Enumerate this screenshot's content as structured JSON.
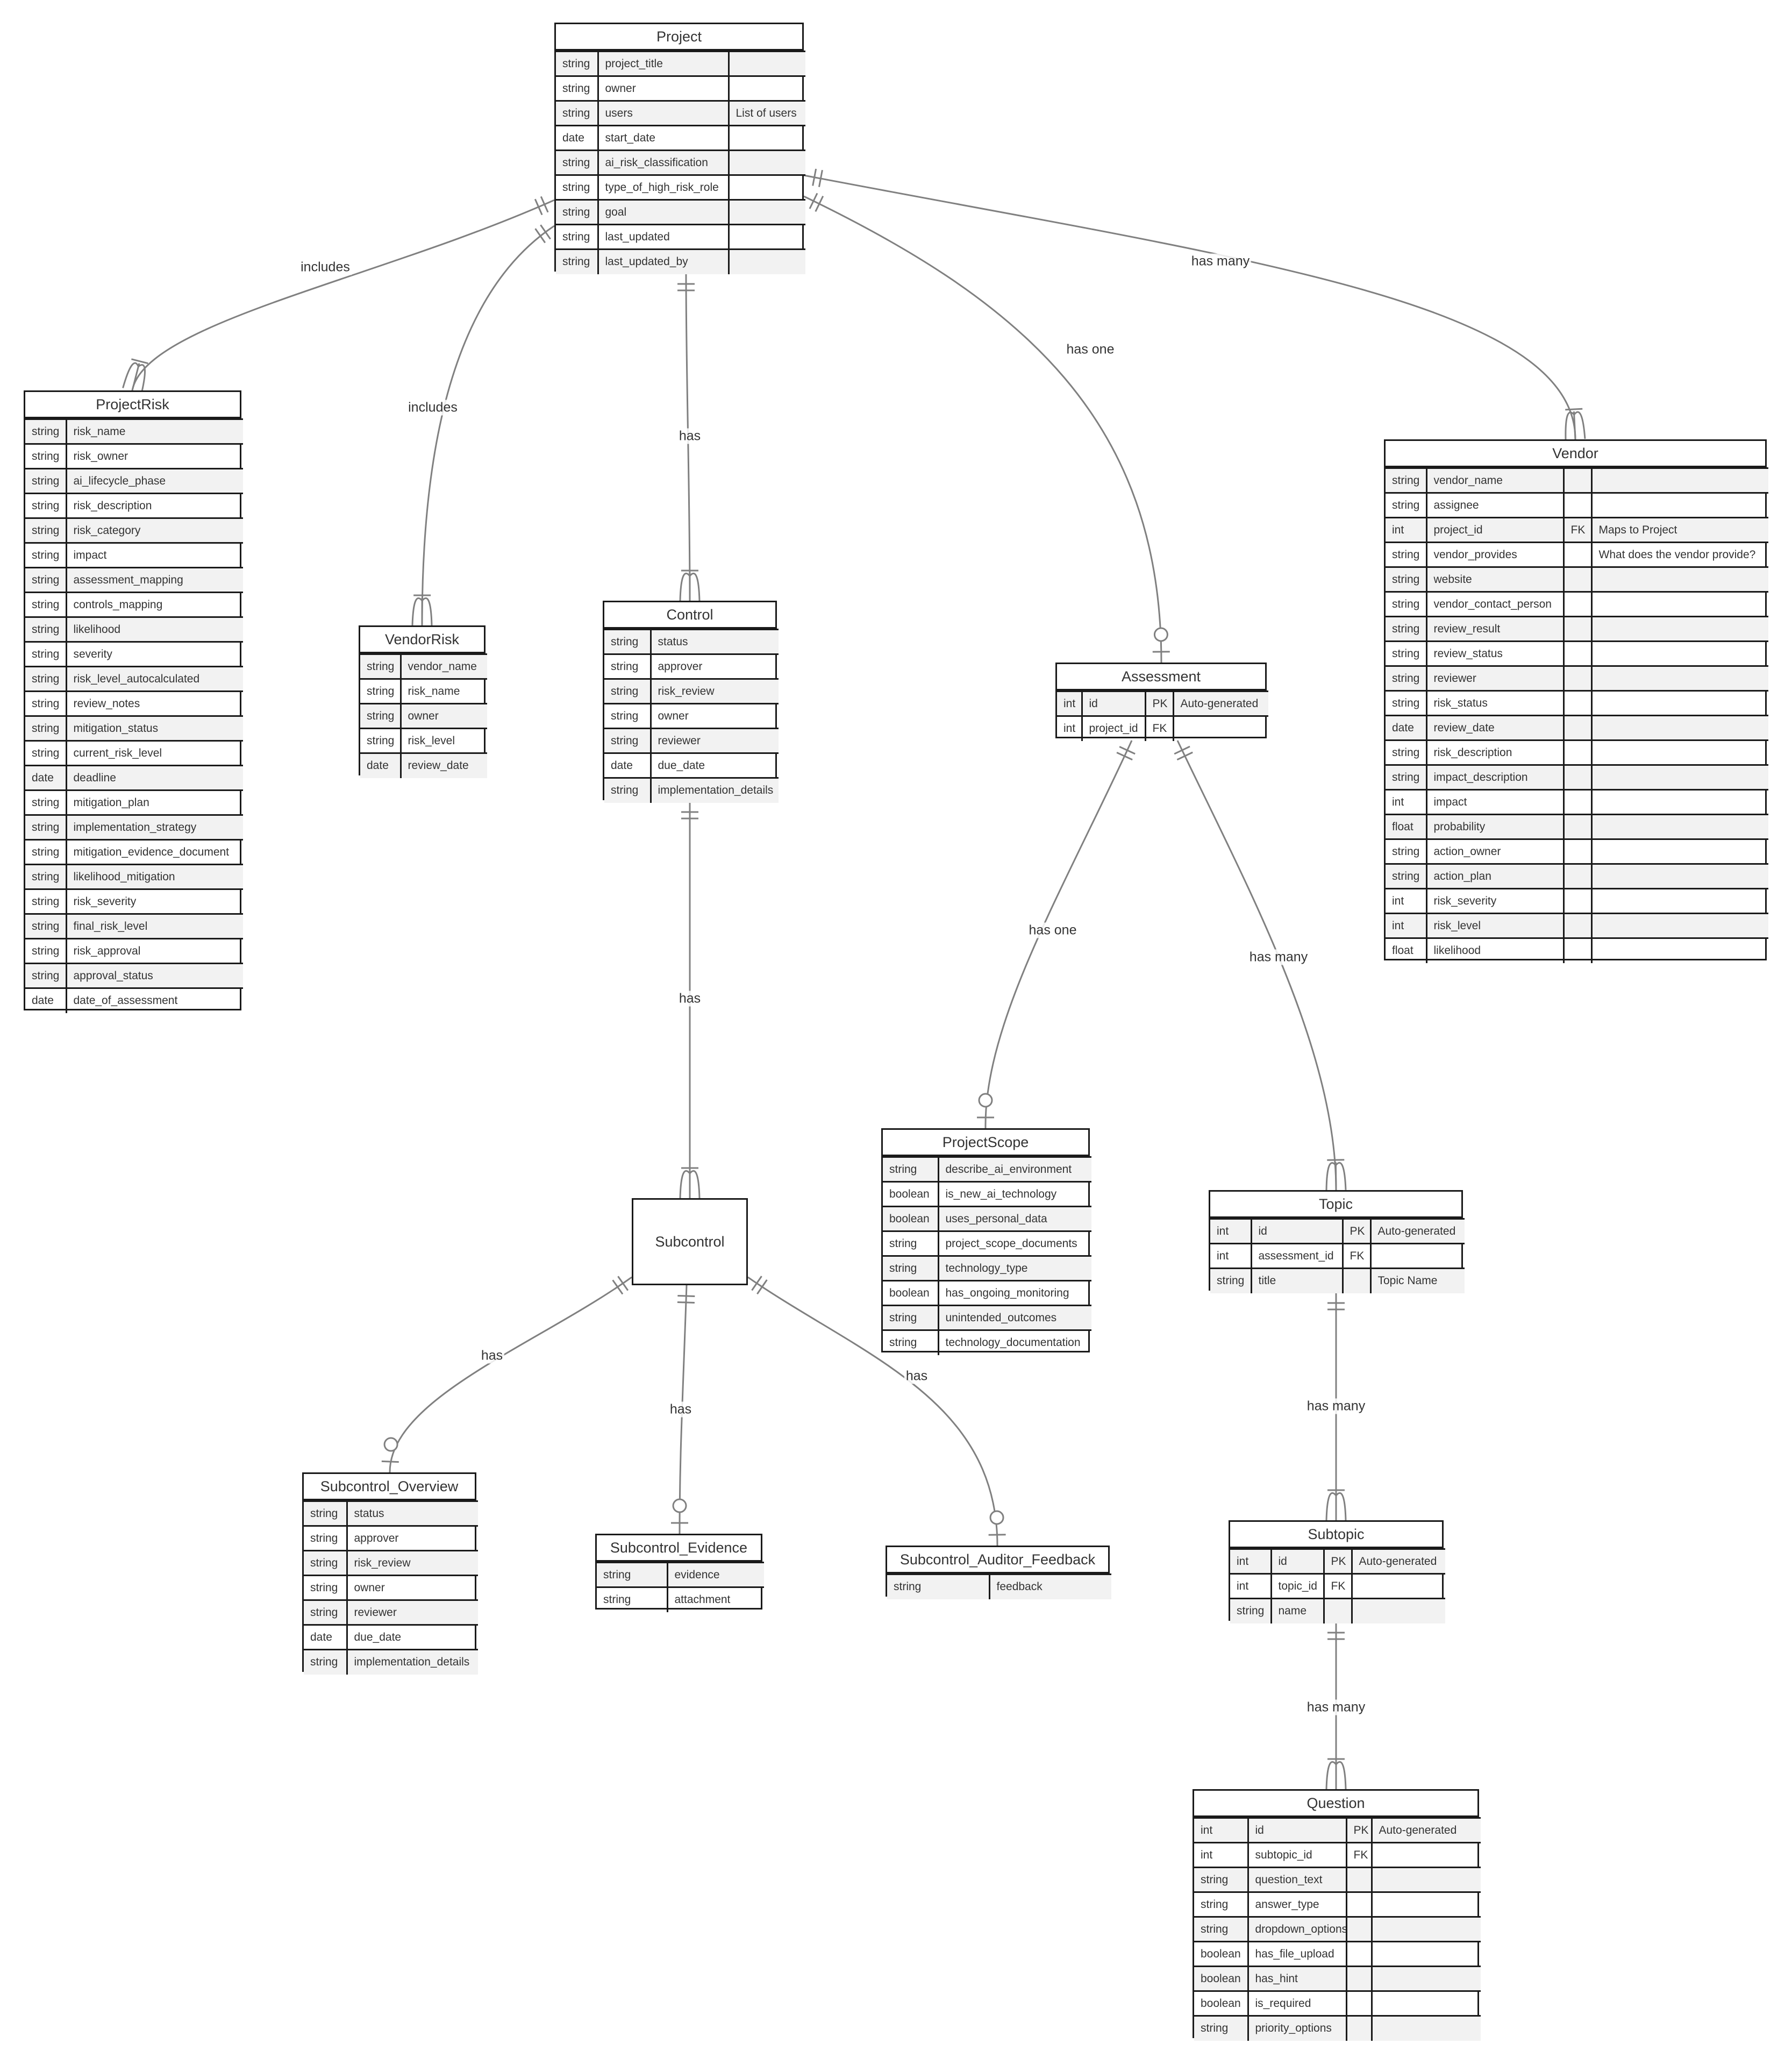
{
  "diagram": {
    "type": "er",
    "entities": [
      {
        "id": "project",
        "name": "Project",
        "columns": 3,
        "attributes": [
          {
            "type": "string",
            "name": "project_title",
            "comment": ""
          },
          {
            "type": "string",
            "name": "owner",
            "comment": ""
          },
          {
            "type": "string",
            "name": "users",
            "comment": "List of users"
          },
          {
            "type": "date",
            "name": "start_date",
            "comment": ""
          },
          {
            "type": "string",
            "name": "ai_risk_classification",
            "comment": ""
          },
          {
            "type": "string",
            "name": "type_of_high_risk_role",
            "comment": ""
          },
          {
            "type": "string",
            "name": "goal",
            "comment": ""
          },
          {
            "type": "string",
            "name": "last_updated",
            "comment": ""
          },
          {
            "type": "string",
            "name": "last_updated_by",
            "comment": ""
          }
        ]
      },
      {
        "id": "projectrisk",
        "name": "ProjectRisk",
        "columns": 2,
        "attributes": [
          {
            "type": "string",
            "name": "risk_name"
          },
          {
            "type": "string",
            "name": "risk_owner"
          },
          {
            "type": "string",
            "name": "ai_lifecycle_phase"
          },
          {
            "type": "string",
            "name": "risk_description"
          },
          {
            "type": "string",
            "name": "risk_category"
          },
          {
            "type": "string",
            "name": "impact"
          },
          {
            "type": "string",
            "name": "assessment_mapping"
          },
          {
            "type": "string",
            "name": "controls_mapping"
          },
          {
            "type": "string",
            "name": "likelihood"
          },
          {
            "type": "string",
            "name": "severity"
          },
          {
            "type": "string",
            "name": "risk_level_autocalculated"
          },
          {
            "type": "string",
            "name": "review_notes"
          },
          {
            "type": "string",
            "name": "mitigation_status"
          },
          {
            "type": "string",
            "name": "current_risk_level"
          },
          {
            "type": "date",
            "name": "deadline"
          },
          {
            "type": "string",
            "name": "mitigation_plan"
          },
          {
            "type": "string",
            "name": "implementation_strategy"
          },
          {
            "type": "string",
            "name": "mitigation_evidence_document"
          },
          {
            "type": "string",
            "name": "likelihood_mitigation"
          },
          {
            "type": "string",
            "name": "risk_severity"
          },
          {
            "type": "string",
            "name": "final_risk_level"
          },
          {
            "type": "string",
            "name": "risk_approval"
          },
          {
            "type": "string",
            "name": "approval_status"
          },
          {
            "type": "date",
            "name": "date_of_assessment"
          }
        ]
      },
      {
        "id": "vendorrisk",
        "name": "VendorRisk",
        "columns": 2,
        "attributes": [
          {
            "type": "string",
            "name": "vendor_name"
          },
          {
            "type": "string",
            "name": "risk_name"
          },
          {
            "type": "string",
            "name": "owner"
          },
          {
            "type": "string",
            "name": "risk_level"
          },
          {
            "type": "date",
            "name": "review_date"
          }
        ]
      },
      {
        "id": "control",
        "name": "Control",
        "columns": 2,
        "attributes": [
          {
            "type": "string",
            "name": "status"
          },
          {
            "type": "string",
            "name": "approver"
          },
          {
            "type": "string",
            "name": "risk_review"
          },
          {
            "type": "string",
            "name": "owner"
          },
          {
            "type": "string",
            "name": "reviewer"
          },
          {
            "type": "date",
            "name": "due_date"
          },
          {
            "type": "string",
            "name": "implementation_details"
          }
        ]
      },
      {
        "id": "assessment",
        "name": "Assessment",
        "columns": 4,
        "attributes": [
          {
            "type": "int",
            "name": "id",
            "key": "PK",
            "comment": "Auto-generated"
          },
          {
            "type": "int",
            "name": "project_id",
            "key": "FK",
            "comment": ""
          }
        ]
      },
      {
        "id": "vendor",
        "name": "Vendor",
        "columns": 4,
        "attributes": [
          {
            "type": "string",
            "name": "vendor_name",
            "key": "",
            "comment": ""
          },
          {
            "type": "string",
            "name": "assignee",
            "key": "",
            "comment": ""
          },
          {
            "type": "int",
            "name": "project_id",
            "key": "FK",
            "comment": "Maps to Project"
          },
          {
            "type": "string",
            "name": "vendor_provides",
            "key": "",
            "comment": "What does the vendor provide?"
          },
          {
            "type": "string",
            "name": "website",
            "key": "",
            "comment": ""
          },
          {
            "type": "string",
            "name": "vendor_contact_person",
            "key": "",
            "comment": ""
          },
          {
            "type": "string",
            "name": "review_result",
            "key": "",
            "comment": ""
          },
          {
            "type": "string",
            "name": "review_status",
            "key": "",
            "comment": ""
          },
          {
            "type": "string",
            "name": "reviewer",
            "key": "",
            "comment": ""
          },
          {
            "type": "string",
            "name": "risk_status",
            "key": "",
            "comment": ""
          },
          {
            "type": "date",
            "name": "review_date",
            "key": "",
            "comment": ""
          },
          {
            "type": "string",
            "name": "risk_description",
            "key": "",
            "comment": ""
          },
          {
            "type": "string",
            "name": "impact_description",
            "key": "",
            "comment": ""
          },
          {
            "type": "int",
            "name": "impact",
            "key": "",
            "comment": ""
          },
          {
            "type": "float",
            "name": "probability",
            "key": "",
            "comment": ""
          },
          {
            "type": "string",
            "name": "action_owner",
            "key": "",
            "comment": ""
          },
          {
            "type": "string",
            "name": "action_plan",
            "key": "",
            "comment": ""
          },
          {
            "type": "int",
            "name": "risk_severity",
            "key": "",
            "comment": ""
          },
          {
            "type": "int",
            "name": "risk_level",
            "key": "",
            "comment": ""
          },
          {
            "type": "float",
            "name": "likelihood",
            "key": "",
            "comment": ""
          }
        ]
      },
      {
        "id": "projectscope",
        "name": "ProjectScope",
        "columns": 2,
        "attributes": [
          {
            "type": "string",
            "name": "describe_ai_environment"
          },
          {
            "type": "boolean",
            "name": "is_new_ai_technology"
          },
          {
            "type": "boolean",
            "name": "uses_personal_data"
          },
          {
            "type": "string",
            "name": "project_scope_documents"
          },
          {
            "type": "string",
            "name": "technology_type"
          },
          {
            "type": "boolean",
            "name": "has_ongoing_monitoring"
          },
          {
            "type": "string",
            "name": "unintended_outcomes"
          },
          {
            "type": "string",
            "name": "technology_documentation"
          }
        ]
      },
      {
        "id": "topic",
        "name": "Topic",
        "columns": 4,
        "attributes": [
          {
            "type": "int",
            "name": "id",
            "key": "PK",
            "comment": "Auto-generated"
          },
          {
            "type": "int",
            "name": "assessment_id",
            "key": "FK",
            "comment": ""
          },
          {
            "type": "string",
            "name": "title",
            "key": "",
            "comment": "Topic Name"
          }
        ]
      },
      {
        "id": "subcontrol",
        "name": "Subcontrol",
        "columns": 0,
        "attributes": []
      },
      {
        "id": "subcontrol_overview",
        "name": "Subcontrol_Overview",
        "columns": 2,
        "attributes": [
          {
            "type": "string",
            "name": "status"
          },
          {
            "type": "string",
            "name": "approver"
          },
          {
            "type": "string",
            "name": "risk_review"
          },
          {
            "type": "string",
            "name": "owner"
          },
          {
            "type": "string",
            "name": "reviewer"
          },
          {
            "type": "date",
            "name": "due_date"
          },
          {
            "type": "string",
            "name": "implementation_details"
          }
        ]
      },
      {
        "id": "subcontrol_evidence",
        "name": "Subcontrol_Evidence",
        "columns": 2,
        "attributes": [
          {
            "type": "string",
            "name": "evidence"
          },
          {
            "type": "string",
            "name": "attachment"
          }
        ]
      },
      {
        "id": "subcontrol_auditor_feedback",
        "name": "Subcontrol_Auditor_Feedback",
        "columns": 2,
        "attributes": [
          {
            "type": "string",
            "name": "feedback"
          }
        ]
      },
      {
        "id": "subtopic",
        "name": "Subtopic",
        "columns": 4,
        "attributes": [
          {
            "type": "int",
            "name": "id",
            "key": "PK",
            "comment": "Auto-generated"
          },
          {
            "type": "int",
            "name": "topic_id",
            "key": "FK",
            "comment": ""
          },
          {
            "type": "string",
            "name": "name",
            "key": "",
            "comment": ""
          }
        ]
      },
      {
        "id": "question",
        "name": "Question",
        "columns": 4,
        "attributes": [
          {
            "type": "int",
            "name": "id",
            "key": "PK",
            "comment": "Auto-generated"
          },
          {
            "type": "int",
            "name": "subtopic_id",
            "key": "FK",
            "comment": ""
          },
          {
            "type": "string",
            "name": "question_text",
            "key": "",
            "comment": ""
          },
          {
            "type": "string",
            "name": "answer_type",
            "key": "",
            "comment": ""
          },
          {
            "type": "string",
            "name": "dropdown_options",
            "key": "",
            "comment": ""
          },
          {
            "type": "boolean",
            "name": "has_file_upload",
            "key": "",
            "comment": ""
          },
          {
            "type": "boolean",
            "name": "has_hint",
            "key": "",
            "comment": ""
          },
          {
            "type": "boolean",
            "name": "is_required",
            "key": "",
            "comment": ""
          },
          {
            "type": "string",
            "name": "priority_options",
            "key": "",
            "comment": ""
          }
        ]
      }
    ],
    "relationships": [
      {
        "from": "project",
        "to": "projectrisk",
        "label": "includes",
        "from_card": "exactly-one",
        "to_card": "one-or-more"
      },
      {
        "from": "project",
        "to": "vendorrisk",
        "label": "includes",
        "from_card": "exactly-one",
        "to_card": "one-or-more"
      },
      {
        "from": "project",
        "to": "control",
        "label": "has",
        "from_card": "exactly-one",
        "to_card": "one-or-more"
      },
      {
        "from": "project",
        "to": "assessment",
        "label": "has one",
        "from_card": "exactly-one",
        "to_card": "zero-or-one"
      },
      {
        "from": "project",
        "to": "vendor",
        "label": "has many",
        "from_card": "exactly-one",
        "to_card": "one-or-more"
      },
      {
        "from": "control",
        "to": "subcontrol",
        "label": "has",
        "from_card": "exactly-one",
        "to_card": "one-or-more"
      },
      {
        "from": "assessment",
        "to": "projectscope",
        "label": "has one",
        "from_card": "exactly-one",
        "to_card": "zero-or-one"
      },
      {
        "from": "assessment",
        "to": "topic",
        "label": "has many",
        "from_card": "exactly-one",
        "to_card": "one-or-more"
      },
      {
        "from": "subcontrol",
        "to": "subcontrol_overview",
        "label": "has",
        "from_card": "exactly-one",
        "to_card": "zero-or-one"
      },
      {
        "from": "subcontrol",
        "to": "subcontrol_evidence",
        "label": "has",
        "from_card": "exactly-one",
        "to_card": "zero-or-one"
      },
      {
        "from": "subcontrol",
        "to": "subcontrol_auditor_feedback",
        "label": "has",
        "from_card": "exactly-one",
        "to_card": "zero-or-one"
      },
      {
        "from": "topic",
        "to": "subtopic",
        "label": "has many",
        "from_card": "exactly-one",
        "to_card": "one-or-more"
      },
      {
        "from": "subtopic",
        "to": "question",
        "label": "has many",
        "from_card": "exactly-one",
        "to_card": "one-or-more"
      }
    ]
  }
}
